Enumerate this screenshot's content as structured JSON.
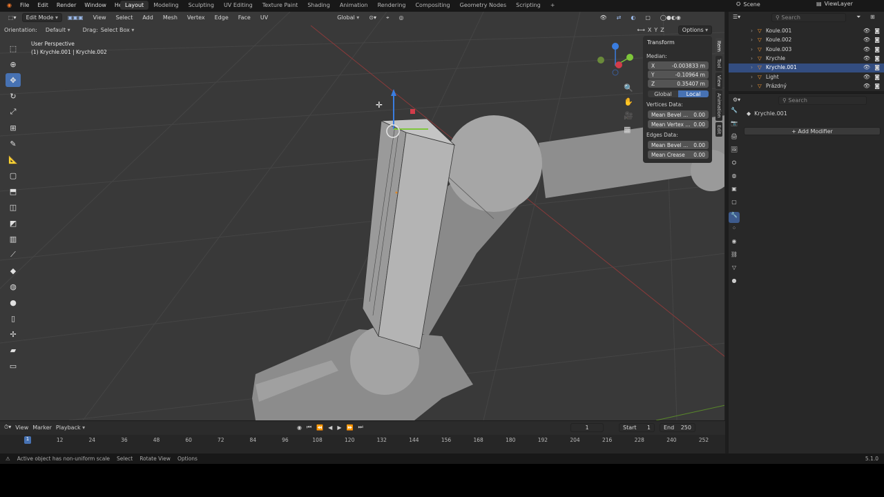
{
  "topbar": {
    "menus": [
      "File",
      "Edit",
      "Render",
      "Window",
      "Help"
    ],
    "workspaces": [
      "Layout",
      "Modeling",
      "Sculpting",
      "UV Editing",
      "Texture Paint",
      "Shading",
      "Animation",
      "Rendering",
      "Compositing",
      "Geometry Nodes",
      "Scripting"
    ],
    "active_workspace": "Layout",
    "scene": "Scene",
    "viewlayer": "ViewLayer"
  },
  "viewport_header": {
    "mode": "Edit Mode",
    "menus": [
      "View",
      "Select",
      "Add",
      "Mesh",
      "Vertex",
      "Edge",
      "Face",
      "UV"
    ],
    "transform_orientation": "Global",
    "options": "Options",
    "axes": [
      "X",
      "Y",
      "Z"
    ]
  },
  "tool_header": {
    "orientation_label": "Orientation:",
    "orientation_value": "Default",
    "drag_label": "Drag:",
    "drag_value": "Select Box"
  },
  "viewport": {
    "view_name": "User Perspective",
    "object_info": "(1) Krychle.001 | Krychle.002"
  },
  "npanel": {
    "title": "Transform",
    "median_label": "Median:",
    "fields": [
      {
        "axis": "X",
        "value": "-0.003833 m"
      },
      {
        "axis": "Y",
        "value": "-0.10964 m"
      },
      {
        "axis": "Z",
        "value": "0.35407 m"
      }
    ],
    "space_buttons": [
      "Global",
      "Local"
    ],
    "active_space": "Local",
    "vertices_label": "Vertices Data:",
    "vertex_fields": [
      {
        "label": "Mean Bevel ...",
        "value": "0.00"
      },
      {
        "label": "Mean Vertex ...",
        "value": "0.00"
      }
    ],
    "edges_label": "Edges Data:",
    "edge_fields": [
      {
        "label": "Mean Bevel ...",
        "value": "0.00"
      },
      {
        "label": "Mean Crease",
        "value": "0.00"
      }
    ],
    "tabs": [
      "Item",
      "Tool",
      "View",
      "Animation",
      "Edit"
    ]
  },
  "outliner": {
    "search_placeholder": "Search",
    "items": [
      {
        "name": "Koule.001",
        "selected": false
      },
      {
        "name": "Koule.002",
        "selected": false
      },
      {
        "name": "Koule.003",
        "selected": false
      },
      {
        "name": "Krychle",
        "selected": false
      },
      {
        "name": "Krychle.001",
        "selected": true
      },
      {
        "name": "Light",
        "selected": false
      },
      {
        "name": "Prázdný",
        "selected": false
      }
    ]
  },
  "properties": {
    "search_placeholder": "Search",
    "object_name": "Krychle.001",
    "add_modifier": "Add Modifier"
  },
  "timeline": {
    "menus": [
      "View",
      "Marker",
      "Playback"
    ],
    "current_frame": "1",
    "start_label": "Start",
    "start": "1",
    "end_label": "End",
    "end": "250",
    "ticks": [
      "1",
      "12",
      "24",
      "36",
      "48",
      "60",
      "72",
      "84",
      "96",
      "108",
      "120",
      "132",
      "144",
      "156",
      "168",
      "180",
      "192",
      "204",
      "216",
      "228",
      "240",
      "252"
    ]
  },
  "status": {
    "warning": "Active object has non-uniform scale",
    "hints": [
      "Select",
      "Rotate View",
      "Options"
    ],
    "version": "5.1.0"
  },
  "colors": {
    "accent": "#4772b3",
    "viewport_bg": "#393939",
    "selected_row": "#334d80"
  }
}
